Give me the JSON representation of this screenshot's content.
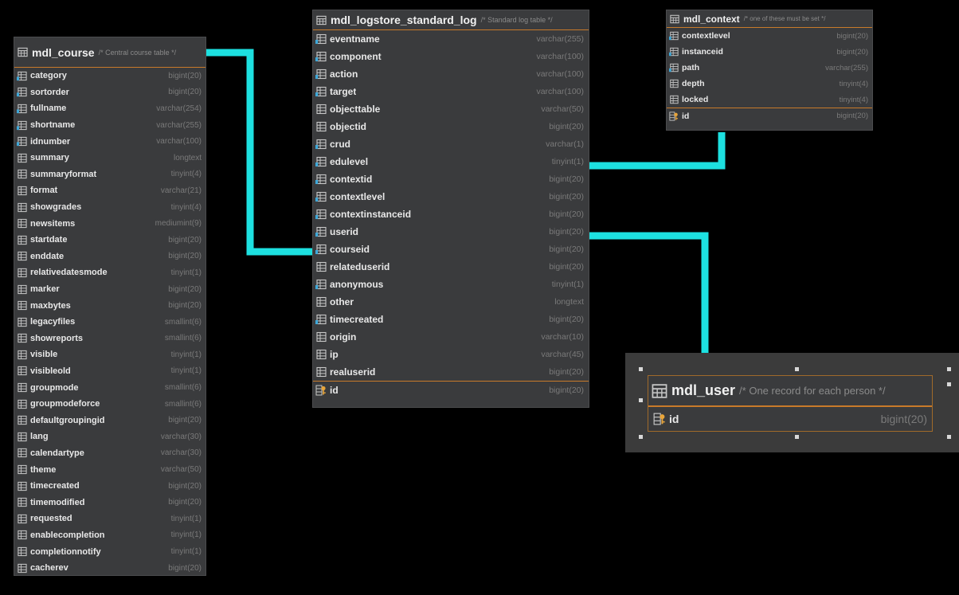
{
  "tables": {
    "course": {
      "name": "mdl_course",
      "comment": "/* Central course table */",
      "columns": [
        {
          "name": "category",
          "type": "bigint(20)",
          "icon": "fk-column-icon"
        },
        {
          "name": "sortorder",
          "type": "bigint(20)",
          "icon": "fk-column-icon"
        },
        {
          "name": "fullname",
          "type": "varchar(254)",
          "icon": "fk-column-icon"
        },
        {
          "name": "shortname",
          "type": "varchar(255)",
          "icon": "fk-column-icon"
        },
        {
          "name": "idnumber",
          "type": "varchar(100)",
          "icon": "fk-column-icon"
        },
        {
          "name": "summary",
          "type": "longtext",
          "icon": "column-icon"
        },
        {
          "name": "summaryformat",
          "type": "tinyint(4)",
          "icon": "column-icon"
        },
        {
          "name": "format",
          "type": "varchar(21)",
          "icon": "column-icon"
        },
        {
          "name": "showgrades",
          "type": "tinyint(4)",
          "icon": "column-icon"
        },
        {
          "name": "newsitems",
          "type": "mediumint(9)",
          "icon": "column-icon"
        },
        {
          "name": "startdate",
          "type": "bigint(20)",
          "icon": "column-icon"
        },
        {
          "name": "enddate",
          "type": "bigint(20)",
          "icon": "column-icon"
        },
        {
          "name": "relativedatesmode",
          "type": "tinyint(1)",
          "icon": "column-icon"
        },
        {
          "name": "marker",
          "type": "bigint(20)",
          "icon": "column-icon"
        },
        {
          "name": "maxbytes",
          "type": "bigint(20)",
          "icon": "column-icon"
        },
        {
          "name": "legacyfiles",
          "type": "smallint(6)",
          "icon": "column-icon"
        },
        {
          "name": "showreports",
          "type": "smallint(6)",
          "icon": "column-icon"
        },
        {
          "name": "visible",
          "type": "tinyint(1)",
          "icon": "column-icon"
        },
        {
          "name": "visibleold",
          "type": "tinyint(1)",
          "icon": "column-icon"
        },
        {
          "name": "groupmode",
          "type": "smallint(6)",
          "icon": "column-icon"
        },
        {
          "name": "groupmodeforce",
          "type": "smallint(6)",
          "icon": "column-icon"
        },
        {
          "name": "defaultgroupingid",
          "type": "bigint(20)",
          "icon": "column-icon"
        },
        {
          "name": "lang",
          "type": "varchar(30)",
          "icon": "column-icon"
        },
        {
          "name": "calendartype",
          "type": "varchar(30)",
          "icon": "column-icon"
        },
        {
          "name": "theme",
          "type": "varchar(50)",
          "icon": "column-icon"
        },
        {
          "name": "timecreated",
          "type": "bigint(20)",
          "icon": "column-icon"
        },
        {
          "name": "timemodified",
          "type": "bigint(20)",
          "icon": "column-icon"
        },
        {
          "name": "requested",
          "type": "tinyint(1)",
          "icon": "column-icon"
        },
        {
          "name": "enablecompletion",
          "type": "tinyint(1)",
          "icon": "column-icon"
        },
        {
          "name": "completionnotify",
          "type": "tinyint(1)",
          "icon": "column-icon"
        },
        {
          "name": "cacherev",
          "type": "bigint(20)",
          "icon": "column-icon"
        }
      ],
      "pk": null
    },
    "log": {
      "name": "mdl_logstore_standard_log",
      "comment": "/* Standard log table */",
      "columns": [
        {
          "name": "eventname",
          "type": "varchar(255)",
          "icon": "fk-column-icon"
        },
        {
          "name": "component",
          "type": "varchar(100)",
          "icon": "fk-column-icon"
        },
        {
          "name": "action",
          "type": "varchar(100)",
          "icon": "fk-column-icon"
        },
        {
          "name": "target",
          "type": "varchar(100)",
          "icon": "fk-column-icon"
        },
        {
          "name": "objecttable",
          "type": "varchar(50)",
          "icon": "column-icon"
        },
        {
          "name": "objectid",
          "type": "bigint(20)",
          "icon": "column-icon"
        },
        {
          "name": "crud",
          "type": "varchar(1)",
          "icon": "fk-column-icon"
        },
        {
          "name": "edulevel",
          "type": "tinyint(1)",
          "icon": "fk-column-icon"
        },
        {
          "name": "contextid",
          "type": "bigint(20)",
          "icon": "fk-column-icon"
        },
        {
          "name": "contextlevel",
          "type": "bigint(20)",
          "icon": "fk-column-icon"
        },
        {
          "name": "contextinstanceid",
          "type": "bigint(20)",
          "icon": "fk-column-icon"
        },
        {
          "name": "userid",
          "type": "bigint(20)",
          "icon": "fk-column-icon"
        },
        {
          "name": "courseid",
          "type": "bigint(20)",
          "icon": "fk-column-icon"
        },
        {
          "name": "relateduserid",
          "type": "bigint(20)",
          "icon": "column-icon"
        },
        {
          "name": "anonymous",
          "type": "tinyint(1)",
          "icon": "fk-column-icon"
        },
        {
          "name": "other",
          "type": "longtext",
          "icon": "column-icon"
        },
        {
          "name": "timecreated",
          "type": "bigint(20)",
          "icon": "fk-column-icon"
        },
        {
          "name": "origin",
          "type": "varchar(10)",
          "icon": "column-icon"
        },
        {
          "name": "ip",
          "type": "varchar(45)",
          "icon": "column-icon"
        },
        {
          "name": "realuserid",
          "type": "bigint(20)",
          "icon": "column-icon"
        }
      ],
      "pk": {
        "name": "id",
        "type": "bigint(20)"
      }
    },
    "context": {
      "name": "mdl_context",
      "comment": "/* one of these must be set */",
      "columns": [
        {
          "name": "contextlevel",
          "type": "bigint(20)",
          "icon": "fk-column-icon"
        },
        {
          "name": "instanceid",
          "type": "bigint(20)",
          "icon": "fk-column-icon"
        },
        {
          "name": "path",
          "type": "varchar(255)",
          "icon": "fk-column-icon"
        },
        {
          "name": "depth",
          "type": "tinyint(4)",
          "icon": "column-icon"
        },
        {
          "name": "locked",
          "type": "tinyint(4)",
          "icon": "column-icon"
        }
      ],
      "pk": {
        "name": "id",
        "type": "bigint(20)"
      }
    },
    "user": {
      "name": "mdl_user",
      "comment": "/* One record for each person */",
      "columns": [],
      "pk": {
        "name": "id",
        "type": "bigint(20)"
      }
    }
  },
  "colors": {
    "connector": "#1de0e0",
    "pk_separator": "#c87a2a",
    "key_icon": "#e8a53a",
    "table_icon": "#c8c8c8"
  }
}
